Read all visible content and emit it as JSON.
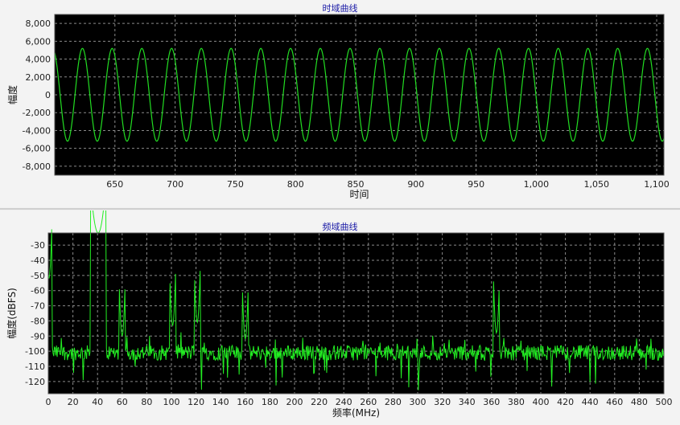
{
  "chart_data": [
    {
      "type": "line",
      "title": "时域曲线",
      "xlabel": "时间",
      "ylabel": "幅度",
      "xlim": [
        600,
        1106
      ],
      "ylim": [
        -9000,
        9000
      ],
      "xticks": [
        650,
        700,
        750,
        800,
        850,
        900,
        950,
        1000,
        1050,
        1100
      ],
      "xtick_labels": [
        "650",
        "700",
        "750",
        "800",
        "850",
        "900",
        "950",
        "1,000",
        "1,050",
        "1,100"
      ],
      "yticks": [
        8000,
        6000,
        4000,
        2000,
        0,
        -2000,
        -4000,
        -6000,
        -8000
      ],
      "ytick_labels": [
        "8,000",
        "6,000",
        "4,000",
        "2,000",
        "0",
        "-2,000",
        "-4,000",
        "-6,000",
        "-8,000"
      ],
      "grid": true,
      "series": [
        {
          "amplitude": 5200,
          "period": 24.7,
          "phase_peak_x": 623,
          "color": "#22dd22"
        }
      ]
    },
    {
      "type": "line",
      "title": "频域曲线",
      "xlabel": "频率(MHz)",
      "ylabel": "幅度(dBFS)",
      "xlim": [
        0,
        500
      ],
      "ylim": [
        -128,
        -22
      ],
      "xticks": [
        0,
        20,
        40,
        60,
        80,
        100,
        120,
        140,
        160,
        180,
        200,
        220,
        240,
        260,
        280,
        300,
        320,
        340,
        360,
        380,
        400,
        420,
        440,
        460,
        480,
        500
      ],
      "yticks": [
        -30,
        -40,
        -50,
        -60,
        -70,
        -80,
        -90,
        -100,
        -110,
        -120
      ],
      "grid": true,
      "noise_floor": -101,
      "peaks": [
        {
          "x": 0.5,
          "y": -52
        },
        {
          "x": 40.5,
          "y": -22
        },
        {
          "x": 101,
          "y": -83
        },
        {
          "x": 121,
          "y": -81
        },
        {
          "x": 60,
          "y": -90
        },
        {
          "x": 160,
          "y": -92
        },
        {
          "x": 364,
          "y": -88
        }
      ],
      "color": "#22ee22"
    }
  ]
}
